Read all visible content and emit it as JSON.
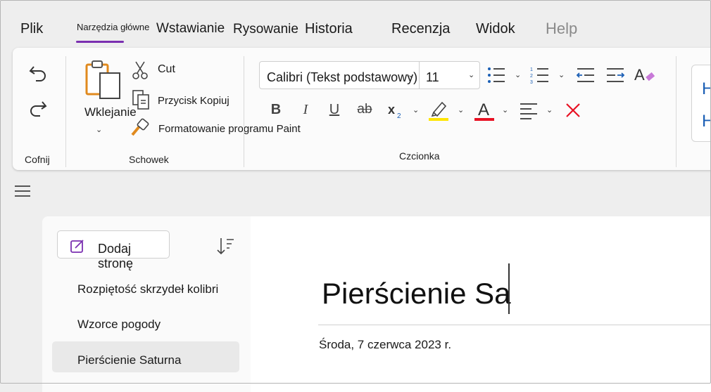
{
  "tabs": {
    "file": "Plik",
    "home": "Narzędzia główne",
    "insert": "Wstawianie",
    "draw": "Rysowanie",
    "history": "Historia",
    "review": "Recenzja",
    "view": "Widok",
    "help": "Help"
  },
  "ribbon": {
    "undo_group": "Cofnij",
    "clipboard": {
      "paste": "Wklejanie",
      "cut": "Cut",
      "copy": "Przycisk Kopiuj",
      "format_painter": "Formatowanie programu Paint",
      "group": "Schowek"
    },
    "font": {
      "name": "Calibri (Tekst podstawowy)",
      "size": "11",
      "group": "Czcionka",
      "highlight_color": "#ffe500",
      "font_color": "#e81123",
      "clear_color": "#e81123"
    },
    "right_card_letters": [
      "H",
      "H"
    ]
  },
  "pages_pane": {
    "add_page": "Dodaj stronę",
    "items": [
      "Rozpiętość skrzydeł kolibri",
      "Wzorce pogody",
      "Pierścienie Saturna"
    ]
  },
  "page": {
    "title": "Pierścienie Sa",
    "date": "Środa, 7 czerwca 2023 r."
  },
  "colors": {
    "accent": "#7a2fb0",
    "clipboard_orange": "#e08a1e"
  }
}
